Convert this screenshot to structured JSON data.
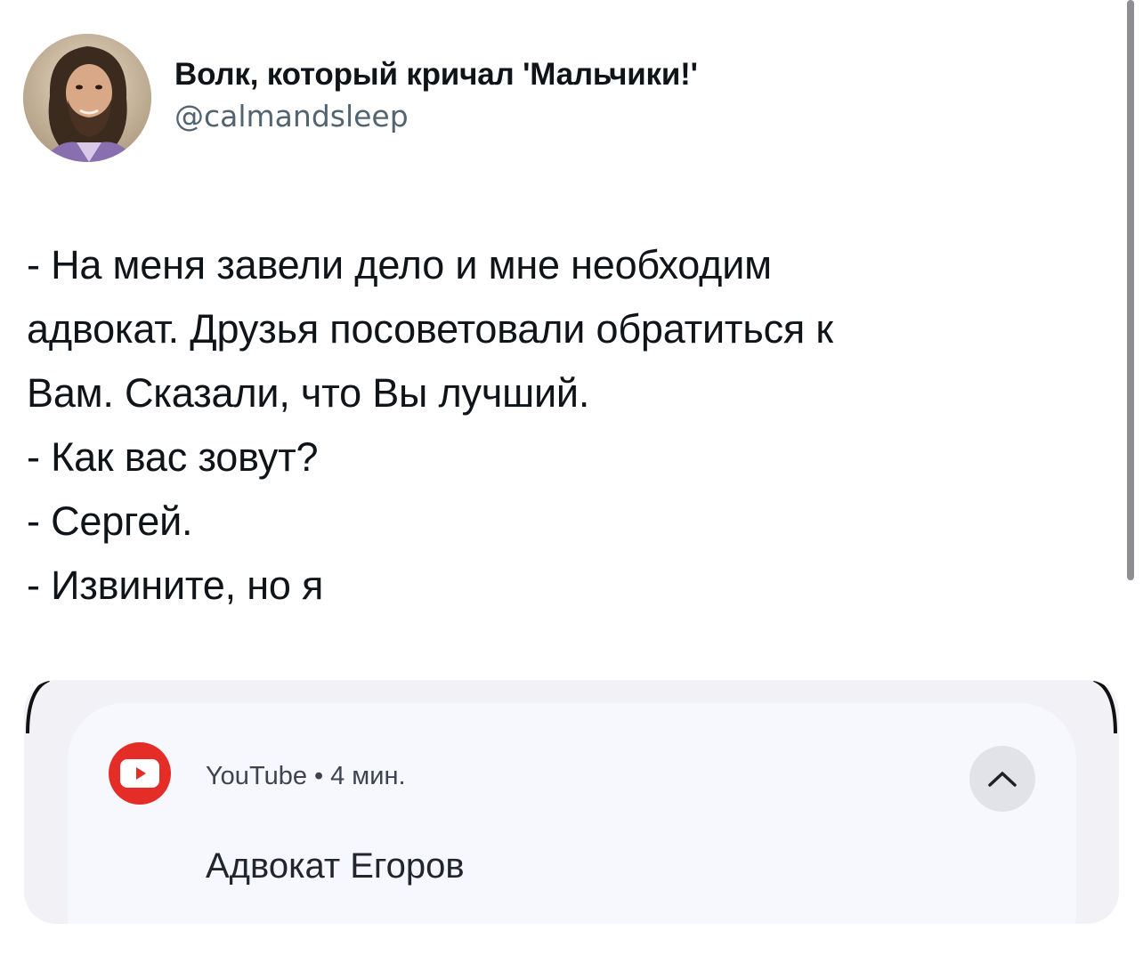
{
  "tweet": {
    "author": {
      "display_name": "Волк, который кричал 'Мальчики!'",
      "handle": "@calmandsleep",
      "avatar_icon": "bearded-man-avatar"
    },
    "text_lines": [
      "- На меня завели дело и мне необходим",
      "адвокат. Друзья посоветовали обратиться к",
      "Вам. Сказали, что Вы лучший.",
      "- Как вас зовут?",
      "- Сергей.",
      "- Извините, но я"
    ]
  },
  "media": {
    "notification": {
      "app_icon": "youtube-icon",
      "app_name": "YouTube",
      "separator": "•",
      "time": "4 мин.",
      "expand_icon": "chevron-up-icon",
      "title": "Адвокат Егоров"
    }
  },
  "colors": {
    "text_primary": "#0f1419",
    "text_secondary": "#536471",
    "youtube_red": "#e52d27",
    "notification_bg": "#f7f8fd"
  }
}
